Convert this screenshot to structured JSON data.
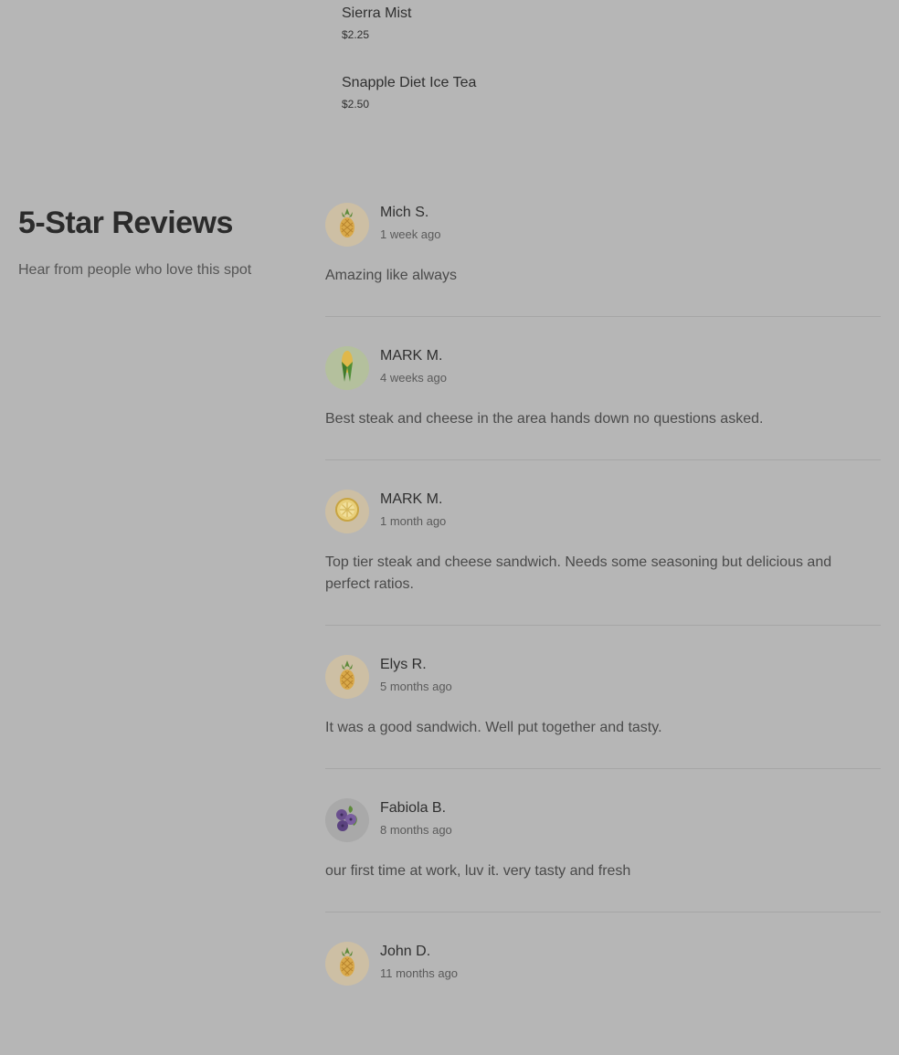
{
  "menu": {
    "items": [
      {
        "name": "Sierra Mist",
        "price": "$2.25"
      },
      {
        "name": "Snapple Diet Ice Tea",
        "price": "$2.50"
      }
    ]
  },
  "reviews_section": {
    "title": "5-Star Reviews",
    "subtitle": "Hear from people who love this spot"
  },
  "reviews": [
    {
      "author": "Mich S.",
      "when": "1 week ago",
      "text": "Amazing like always",
      "avatar_icon": "pineapple-icon"
    },
    {
      "author": "MARK M.",
      "when": "4 weeks ago",
      "text": "Best steak and cheese in the area hands down no questions asked.",
      "avatar_icon": "corn-icon"
    },
    {
      "author": "MARK M.",
      "when": "1 month ago",
      "text": "Top tier steak and cheese sandwich. Needs some seasoning but delicious and perfect ratios.",
      "avatar_icon": "lemon-slice-icon"
    },
    {
      "author": "Elys R.",
      "when": "5 months ago",
      "text": "It was a good sandwich. Well put together and tasty.",
      "avatar_icon": "pineapple-icon"
    },
    {
      "author": "Fabiola B.",
      "when": "8 months ago",
      "text": "our first time at work, luv it. very tasty and fresh",
      "avatar_icon": "blueberry-icon"
    },
    {
      "author": "John D.",
      "when": "11 months ago",
      "text": "",
      "avatar_icon": "pineapple-icon"
    }
  ],
  "colors": {
    "overlay_background": "#b6b6b6",
    "divider": "#a6a6a6",
    "avatar_tan": "#cdbfa4",
    "avatar_green": "#b4c09d",
    "avatar_gray": "#a9a9a9"
  }
}
